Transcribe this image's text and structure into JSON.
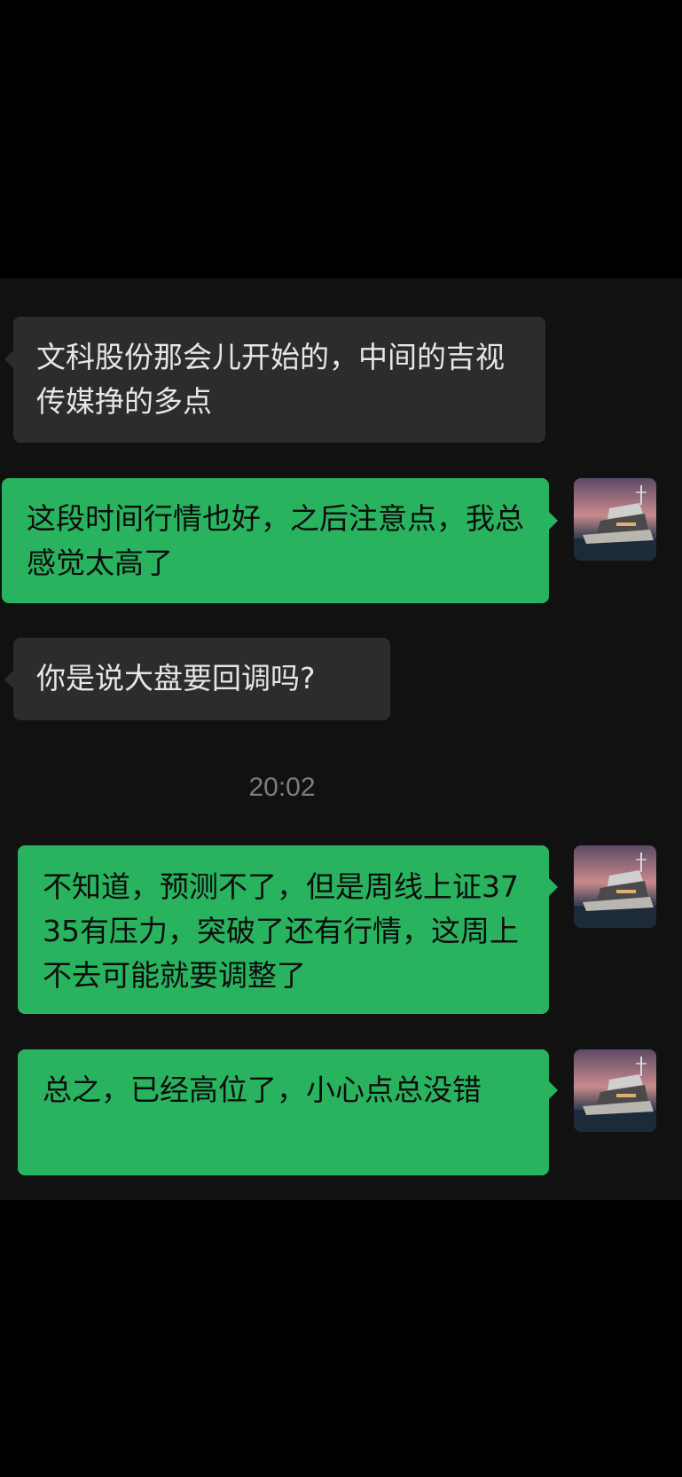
{
  "chat": {
    "messages": [
      {
        "id": "m1",
        "direction": "incoming",
        "text": "文科股份那会儿开始的，中间的吉视传媒挣的多点"
      },
      {
        "id": "m2",
        "direction": "outgoing",
        "text": "这段时间行情也好，之后注意点，我总感觉太高了"
      },
      {
        "id": "m3",
        "direction": "incoming",
        "text": "你是说大盘要回调吗?"
      },
      {
        "id": "m4",
        "direction": "outgoing",
        "text": "不知道，预测不了，但是周线上证3735有压力，突破了还有行情，这周上不去可能就要调整了"
      },
      {
        "id": "m5",
        "direction": "outgoing",
        "text": "总之，已经高位了，小心点总没错"
      }
    ],
    "timestamp": "20:02",
    "avatar_icon": "yacht-avatar-icon"
  },
  "colors": {
    "background": "#000000",
    "chat_background": "#111111",
    "incoming_bubble": "#2c2c2c",
    "outgoing_bubble": "#29b35f",
    "incoming_text": "#e6e6e6",
    "outgoing_text": "#0d0d0d",
    "timestamp_text": "#7d7d7d"
  }
}
